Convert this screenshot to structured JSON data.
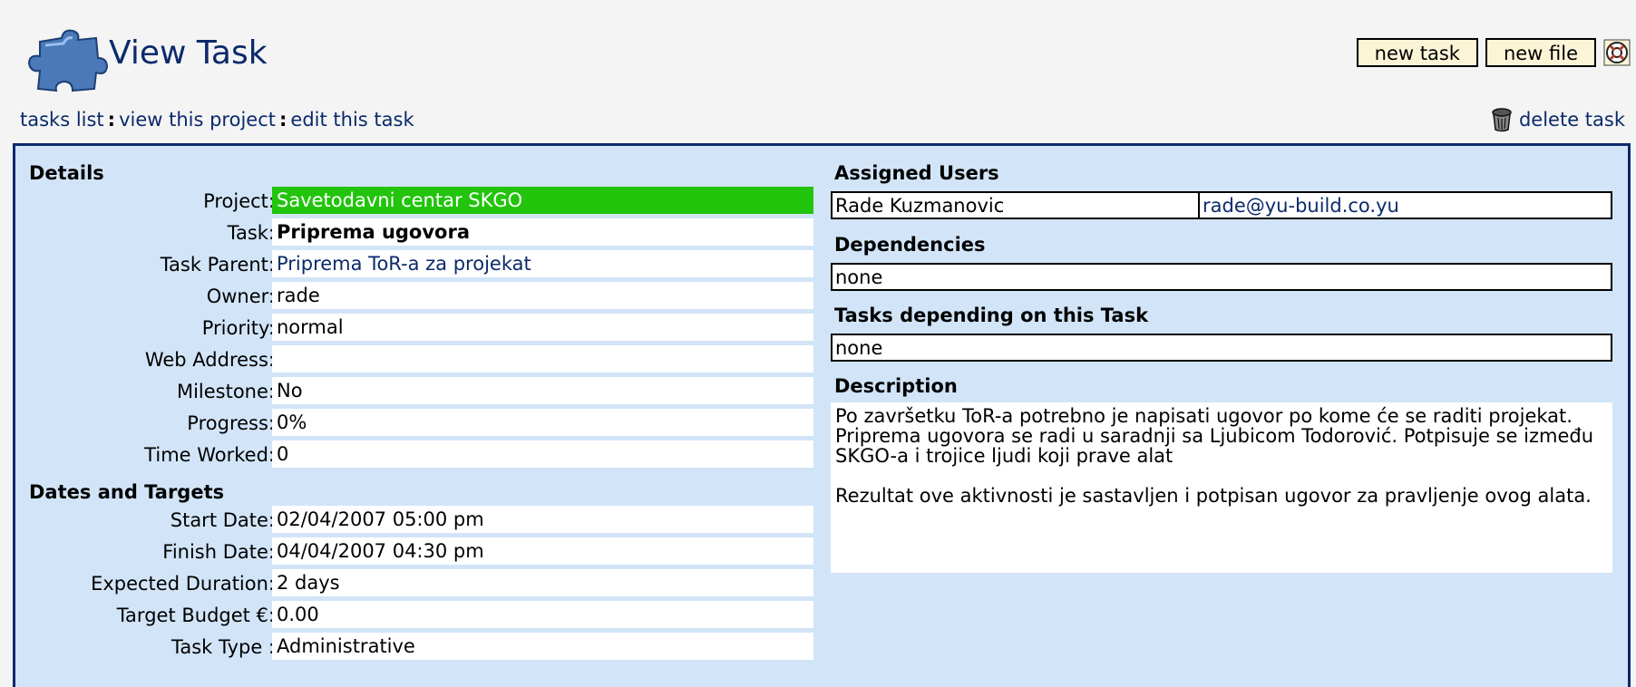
{
  "header": {
    "title": "View Task",
    "buttons": {
      "new_task": "new task",
      "new_file": "new file"
    }
  },
  "breadcrumbs": {
    "tasks_list": "tasks list",
    "view_project": "view this project",
    "edit_task": "edit this task",
    "separator": ":"
  },
  "delete_task": "delete task",
  "details": {
    "title": "Details",
    "fields": [
      {
        "label": "Project:",
        "value": "Savetodavni centar SKGO"
      },
      {
        "label": "Task:",
        "value": "Priprema ugovora"
      },
      {
        "label": "Task Parent:",
        "value": "Priprema ToR-a za projekat"
      },
      {
        "label": "Owner:",
        "value": "rade"
      },
      {
        "label": "Priority:",
        "value": "normal"
      },
      {
        "label": "Web Address:",
        "value": ""
      },
      {
        "label": "Milestone:",
        "value": "No"
      },
      {
        "label": "Progress:",
        "value": "0%"
      },
      {
        "label": "Time Worked:",
        "value": "0"
      }
    ]
  },
  "dates": {
    "title": "Dates and Targets",
    "fields": [
      {
        "label": "Start Date:",
        "value": "02/04/2007 05:00 pm"
      },
      {
        "label": "Finish Date:",
        "value": "04/04/2007 04:30 pm"
      },
      {
        "label": "Expected Duration:",
        "value": "2 days"
      },
      {
        "label": "Target Budget €:",
        "value": "0.00"
      },
      {
        "label": "Task Type :",
        "value": "Administrative"
      }
    ]
  },
  "assigned_users": {
    "title": "Assigned Users",
    "users": [
      {
        "name": "Rade Kuzmanovic",
        "email": "rade@yu-build.co.yu"
      }
    ]
  },
  "dependencies": {
    "title": "Dependencies",
    "value": "none"
  },
  "depending": {
    "title": "Tasks depending on this Task",
    "value": "none"
  },
  "description": {
    "title": "Description",
    "text": "Po završetku ToR-a potrebno je napisati ugovor po kome će se raditi projekat.\nPriprema ugovora se radi u saradnji sa Ljubicom Todorović. Potpisuje se između SKGO-a i trojice ljudi koji prave alat\n\nRezultat ove aktivnosti je sastavljen i potpisan ugovor za pravljenje ovog alata."
  },
  "colors": {
    "accent": "#0b2a6b",
    "panel_bg": "#d2e5f8",
    "project_bg": "#22c40c"
  }
}
